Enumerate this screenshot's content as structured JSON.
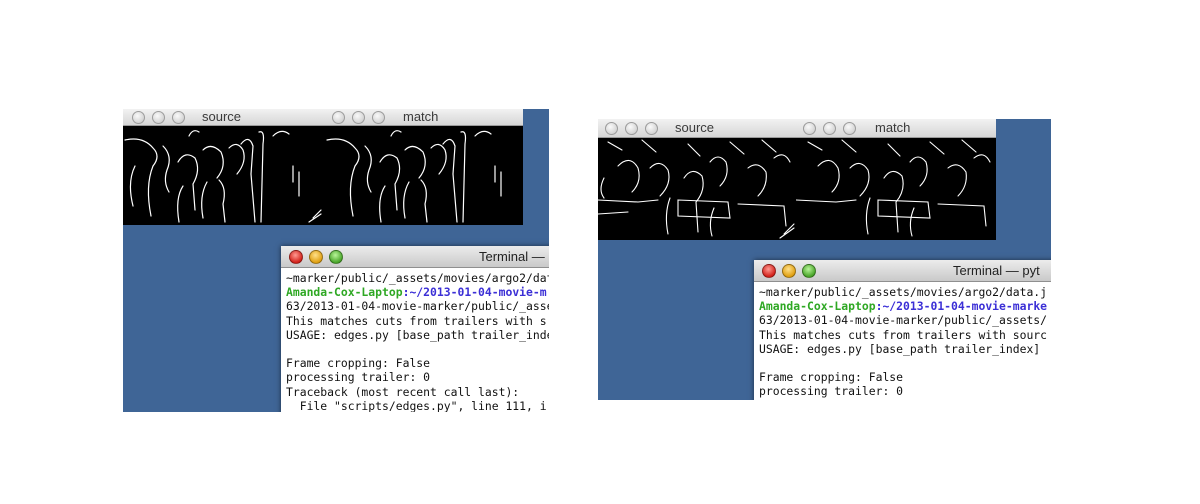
{
  "left": {
    "source_window": {
      "title": "source"
    },
    "match_window": {
      "title": "match"
    },
    "terminal": {
      "title": "Terminal — ",
      "prompt_host": "Amanda-Cox-Laptop",
      "prompt_sep": ":",
      "prompt_path": "~/2013-01-04-movie-m",
      "lines": [
        "~marker/public/_assets/movies/argo2/data",
        "63/2013-01-04-movie-marker/public/_asse",
        "This matches cuts from trailers with s",
        "USAGE: edges.py [base_path trailer_inde",
        "",
        "Frame cropping: False",
        "processing trailer: 0",
        "Traceback (most recent call last):",
        "  File \"scripts/edges.py\", line 111, i"
      ]
    }
  },
  "right": {
    "source_window": {
      "title": "source"
    },
    "match_window": {
      "title": "match"
    },
    "terminal": {
      "title": "Terminal — pyt",
      "prompt_host": "Amanda-Cox-Laptop",
      "prompt_sep": ":",
      "prompt_path": "~/2013-01-04-movie-marke",
      "lines": [
        "~marker/public/_assets/movies/argo2/data.j",
        "63/2013-01-04-movie-marker/public/_assets/",
        "This matches cuts from trailers with sourc",
        "USAGE: edges.py [base_path trailer_index]",
        "",
        "Frame cropping: False",
        "processing trailer: 0"
      ]
    }
  },
  "colors": {
    "desktop": "#3f6596",
    "prompt_host": "#2fa824",
    "prompt_path": "#3b2fd6"
  }
}
